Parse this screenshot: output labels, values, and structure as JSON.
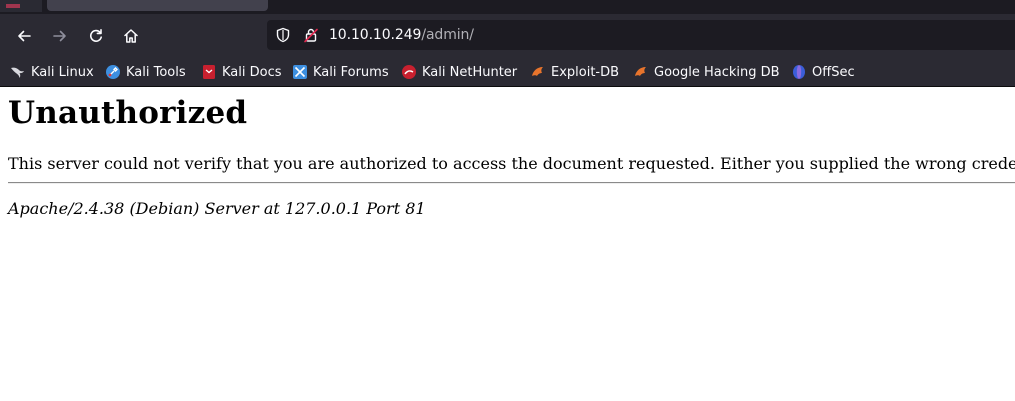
{
  "browser": {
    "url_host": "10.10.10.249",
    "url_path": "/admin/"
  },
  "bookmarks": [
    {
      "label": "Kali Linux",
      "icon": "kali-dragon-icon"
    },
    {
      "label": "Kali Tools",
      "icon": "kali-tools-icon"
    },
    {
      "label": "Kali Docs",
      "icon": "kali-docs-icon"
    },
    {
      "label": "Kali Forums",
      "icon": "kali-forums-icon"
    },
    {
      "label": "Kali NetHunter",
      "icon": "kali-nethunter-icon"
    },
    {
      "label": "Exploit-DB",
      "icon": "exploit-db-icon"
    },
    {
      "label": "Google Hacking DB",
      "icon": "google-hacking-db-icon"
    },
    {
      "label": "OffSec",
      "icon": "offsec-icon"
    }
  ],
  "page": {
    "heading": "Unauthorized",
    "message": "This server could not verify that you are authorized to access the document requested. Either you supplied the wrong crede",
    "server_signature": "Apache/2.4.38 (Debian) Server at 127.0.0.1 Port 81"
  },
  "colors": {
    "chrome_bg": "#2b2a33",
    "urlbar_bg": "#1c1b22",
    "text_light": "#fbfbfe",
    "page_bg": "#ffffff"
  }
}
